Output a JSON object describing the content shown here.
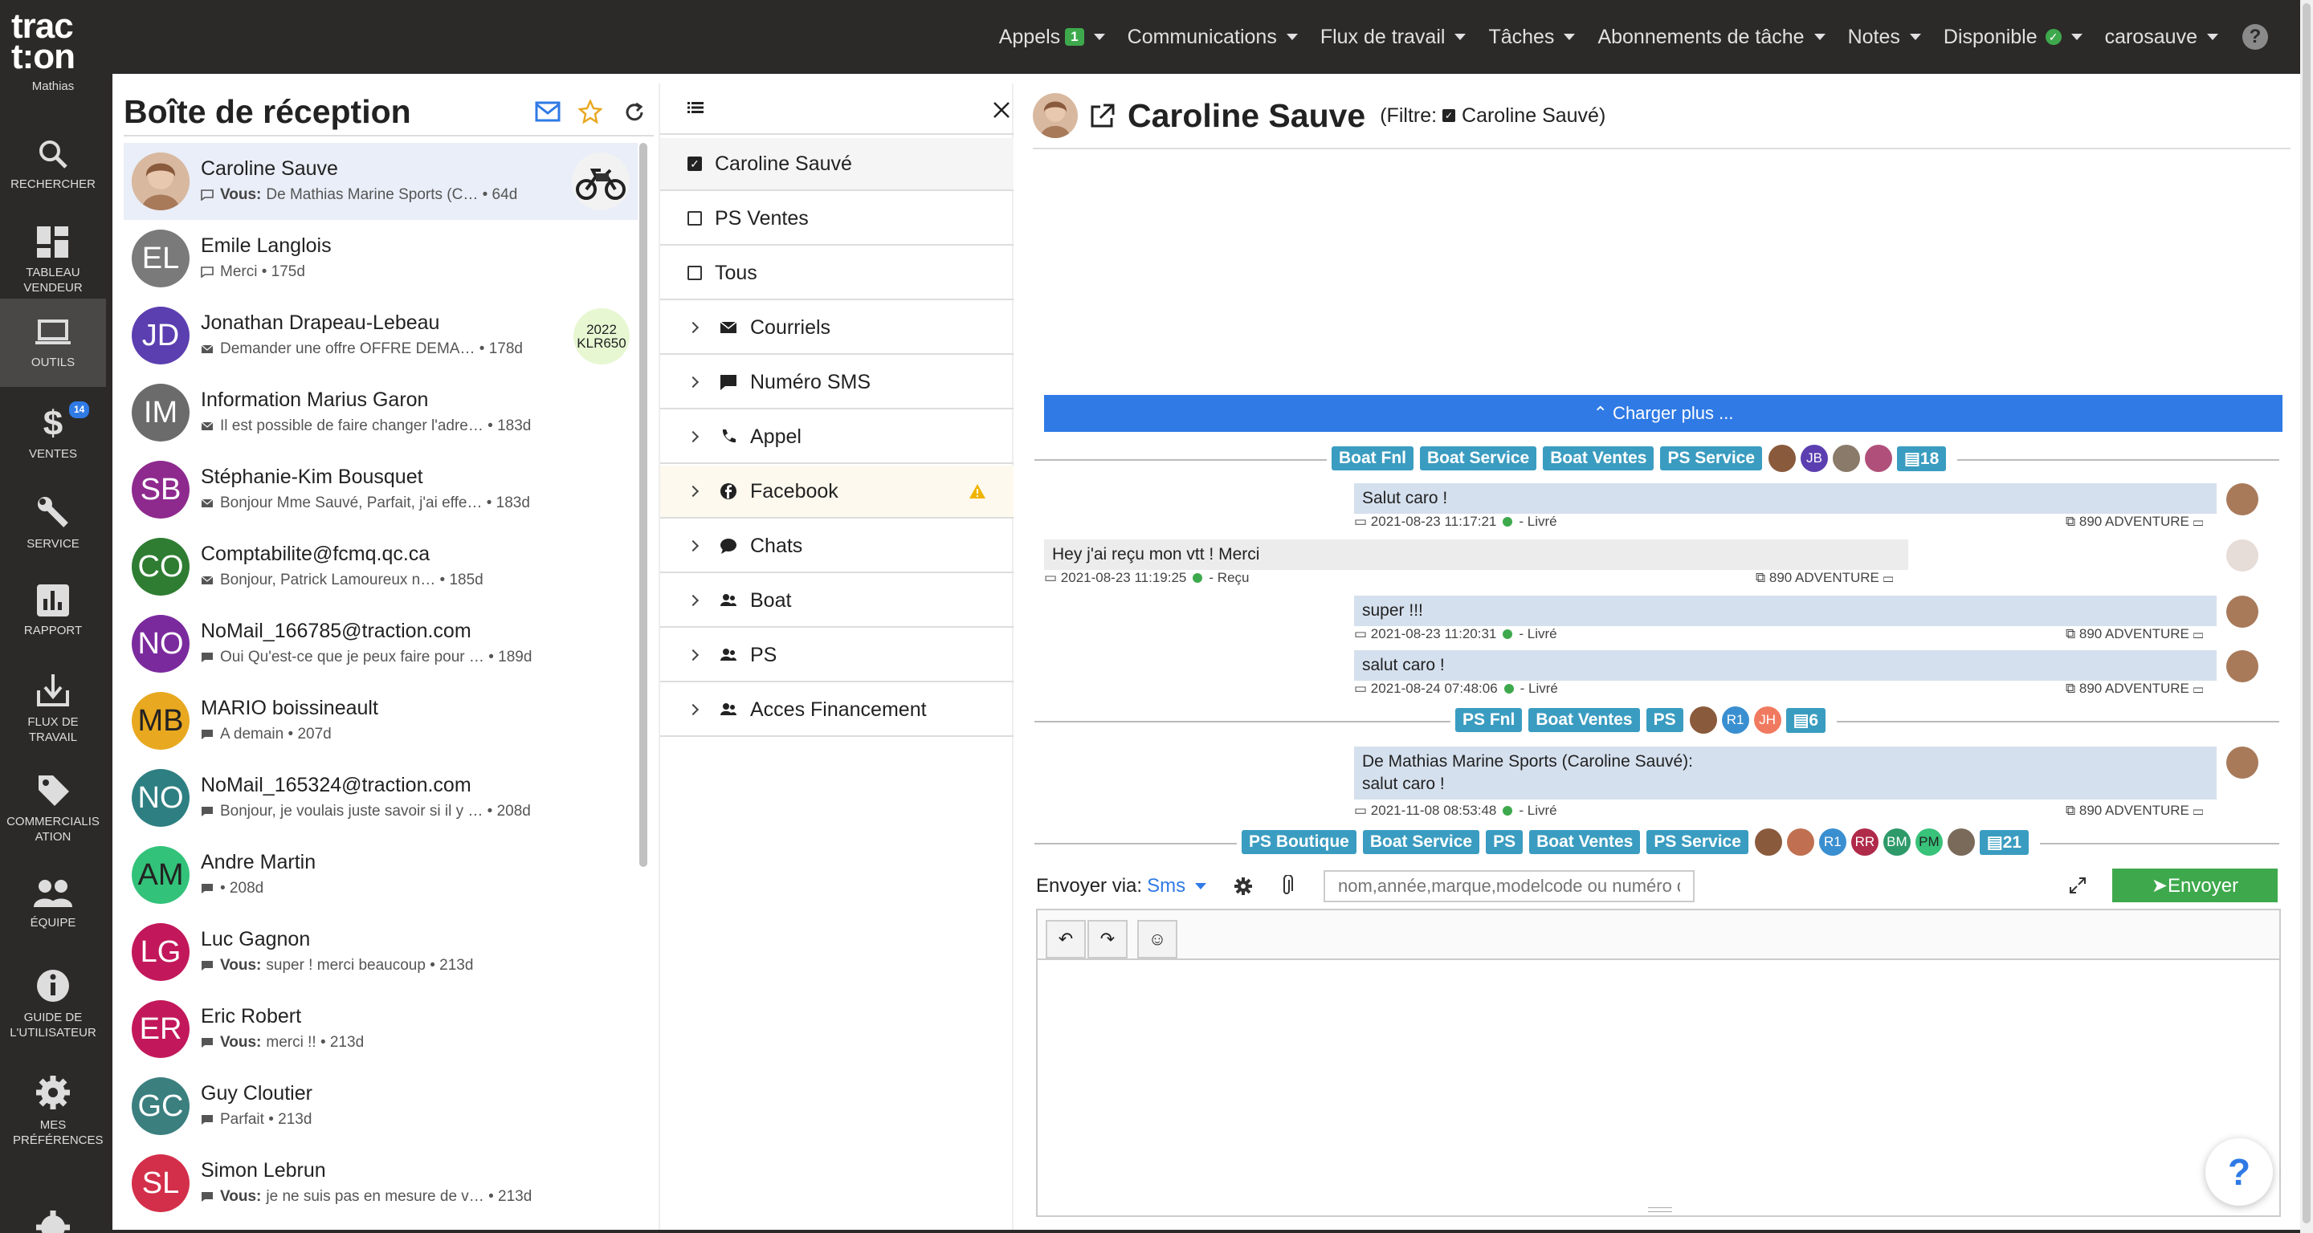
{
  "app": {
    "logo": "trac t:on",
    "logo_line1": "trac",
    "logo_line2": "t:on",
    "user": "Mathias"
  },
  "topnav": {
    "appels": "Appels",
    "appels_badge": "1",
    "communications": "Communications",
    "flux": "Flux de travail",
    "taches": "Tâches",
    "abonnements": "Abonnements de tâche",
    "notes": "Notes",
    "disponible": "Disponible",
    "user": "carosauve",
    "help": "?"
  },
  "sidebar": {
    "items": [
      {
        "label": "RECHERCHER"
      },
      {
        "label": "TABLEAU VENDEUR"
      },
      {
        "label": "OUTILS"
      },
      {
        "label": "VENTES",
        "badge": "14"
      },
      {
        "label": "SERVICE"
      },
      {
        "label": "RAPPORT"
      },
      {
        "label": "FLUX DE TRAVAIL"
      },
      {
        "label": "COMMERCIALISATION"
      },
      {
        "label": "ÉQUIPE"
      },
      {
        "label": "GUIDE DE L'UTILISATEUR"
      },
      {
        "label": "MES PRÉFÉRENCES"
      }
    ]
  },
  "inbox": {
    "title": "Boîte de réception",
    "conversations": [
      {
        "initials": "",
        "name": "Caroline Sauve",
        "prefix": "Vous:",
        "preview": "De Mathias Marine Sports (C…",
        "age": "• 64d",
        "color": "#c99a7a"
      },
      {
        "initials": "EL",
        "name": "Emile Langlois",
        "prefix": "",
        "preview": "Merci",
        "age": "• 175d",
        "color": "#7a7a7a"
      },
      {
        "initials": "JD",
        "name": "Jonathan Drapeau-Lebeau",
        "prefix": "",
        "preview": "Demander une offre OFFRE DEMA…",
        "age": "• 178d",
        "color": "#5b3fb0",
        "badge_line1": "2022",
        "badge_line2": "KLR650"
      },
      {
        "initials": "IM",
        "name": "Information Marius Garon",
        "prefix": "",
        "preview": "Il est possible de faire changer l'adre…",
        "age": "• 183d",
        "color": "#6b6b6b"
      },
      {
        "initials": "SB",
        "name": "Stéphanie-Kim Bousquet",
        "prefix": "",
        "preview": "Bonjour Mme Sauvé, Parfait, j'ai effe…",
        "age": "• 183d",
        "color": "#8e2a8e"
      },
      {
        "initials": "CO",
        "name": "Comptabilite@fcmq.qc.ca",
        "prefix": "",
        "preview": "Bonjour, Patrick Lamoureux n…",
        "age": "• 185d",
        "color": "#2e7d32"
      },
      {
        "initials": "NO",
        "name": "NoMail_166785@traction.com",
        "prefix": "",
        "preview": "Oui Qu'est-ce que je peux faire pour …",
        "age": "• 189d",
        "color": "#7b2a9e"
      },
      {
        "initials": "MB",
        "name": "MARIO boissineault",
        "prefix": "",
        "preview": "A demain",
        "age": "• 207d",
        "color": "#e8a820",
        "text": "#222"
      },
      {
        "initials": "NO",
        "name": "NoMail_165324@traction.com",
        "prefix": "",
        "preview": "Bonjour, je voulais juste savoir si il y …",
        "age": "• 208d",
        "color": "#2e7f82"
      },
      {
        "initials": "AM",
        "name": "Andre Martin",
        "prefix": "",
        "preview": "",
        "age": "• 208d",
        "color": "#33c27a",
        "text": "#222"
      },
      {
        "initials": "LG",
        "name": "Luc Gagnon",
        "prefix": "Vous:",
        "preview": "super ! merci beaucoup",
        "age": "• 213d",
        "color": "#c2185b"
      },
      {
        "initials": "ER",
        "name": "Eric Robert",
        "prefix": "Vous:",
        "preview": "merci !!",
        "age": "• 213d",
        "color": "#c2185b"
      },
      {
        "initials": "GC",
        "name": "Guy Cloutier",
        "prefix": "",
        "preview": "Parfait",
        "age": "• 213d",
        "color": "#3b7f7f"
      },
      {
        "initials": "SL",
        "name": "Simon Lebrun",
        "prefix": "Vous:",
        "preview": "je ne suis pas en mesure de v…",
        "age": "• 213d",
        "color": "#d32f4a"
      }
    ]
  },
  "filters": {
    "items": [
      {
        "label": "Caroline Sauvé",
        "kind": "check",
        "checked": true
      },
      {
        "label": "PS Ventes",
        "kind": "check",
        "checked": false
      },
      {
        "label": "Tous",
        "kind": "check",
        "checked": false
      },
      {
        "label": "Courriels",
        "kind": "group",
        "icon": "envelope-icon"
      },
      {
        "label": "Numéro SMS",
        "kind": "group",
        "icon": "sms-icon"
      },
      {
        "label": "Appel",
        "kind": "group",
        "icon": "phone-icon"
      },
      {
        "label": "Facebook",
        "kind": "group",
        "icon": "facebook-icon",
        "warning": true
      },
      {
        "label": "Chats",
        "kind": "group",
        "icon": "chat-icon"
      },
      {
        "label": "Boat",
        "kind": "group",
        "icon": "users-icon"
      },
      {
        "label": "PS",
        "kind": "group",
        "icon": "users-icon"
      },
      {
        "label": "Acces Financement",
        "kind": "group",
        "icon": "users-icon"
      }
    ]
  },
  "thread": {
    "name": "Caroline Sauve",
    "filter_prefix": "(Filtre:",
    "filter_name": "Caroline Sauvé)",
    "load_more": "⌃ Charger plus ...",
    "group1": {
      "tags": [
        "Boat Fnl",
        "Boat Service",
        "Boat Ventes",
        "PS Service"
      ],
      "avatars": [
        {
          "i": "",
          "c": "#8a5a3c"
        },
        {
          "i": "JB",
          "c": "#5b3fb0"
        },
        {
          "i": "",
          "c": "#8a7a6a"
        },
        {
          "i": "",
          "c": "#b0507a"
        }
      ],
      "count": "18"
    },
    "group2": {
      "tags": [
        "PS Fnl",
        "Boat Ventes",
        "PS"
      ],
      "avatars": [
        {
          "i": "",
          "c": "#8a5a3c"
        },
        {
          "i": "R1",
          "c": "#3a8fd0"
        },
        {
          "i": "JH",
          "c": "#f07a60"
        }
      ],
      "count": "6"
    },
    "group3": {
      "tags": [
        "PS Boutique",
        "Boat Service",
        "PS",
        "Boat Ventes",
        "PS Service"
      ],
      "avatars": [
        {
          "i": "",
          "c": "#8a5a3c"
        },
        {
          "i": "",
          "c": "#c07050"
        },
        {
          "i": "R1",
          "c": "#3a8fd0"
        },
        {
          "i": "RR",
          "c": "#b02a4a"
        },
        {
          "i": "BM",
          "c": "#2e9a6a"
        },
        {
          "i": "PM",
          "c": "#38c27a"
        },
        {
          "i": "",
          "c": "#7a6a5a"
        }
      ],
      "count": "21"
    },
    "messages": [
      {
        "text": "Salut caro !",
        "time": "2021-08-23 11:17:21",
        "status": "- Livré",
        "vehicle": "890 ADVENTURE",
        "dir": "out"
      },
      {
        "text": "Hey j'ai reçu mon vtt ! Merci",
        "time": "2021-08-23 11:19:25",
        "status": "- Reçu",
        "vehicle": "890 ADVENTURE",
        "dir": "in"
      },
      {
        "text": "super !!!",
        "time": "2021-08-23 11:20:31",
        "status": "- Livré",
        "vehicle": "890 ADVENTURE",
        "dir": "out"
      },
      {
        "text": "salut caro !",
        "time": "2021-08-24 07:48:06",
        "status": "- Livré",
        "vehicle": "890 ADVENTURE",
        "dir": "out"
      },
      {
        "text1": "De Mathias Marine Sports (Caroline Sauvé):",
        "text2": "salut caro !",
        "time": "2021-11-08 08:53:48",
        "status": "- Livré",
        "vehicle": "890 ADVENTURE",
        "dir": "out"
      }
    ]
  },
  "composer": {
    "via_label": "Envoyer via:",
    "channel": "Sms",
    "placeholder": "nom,année,marque,modelcode ou numéro de série",
    "send": "➤Envoyer",
    "undo": "↶",
    "redo": "↷",
    "emoji": "☺"
  },
  "help_fab": "?"
}
